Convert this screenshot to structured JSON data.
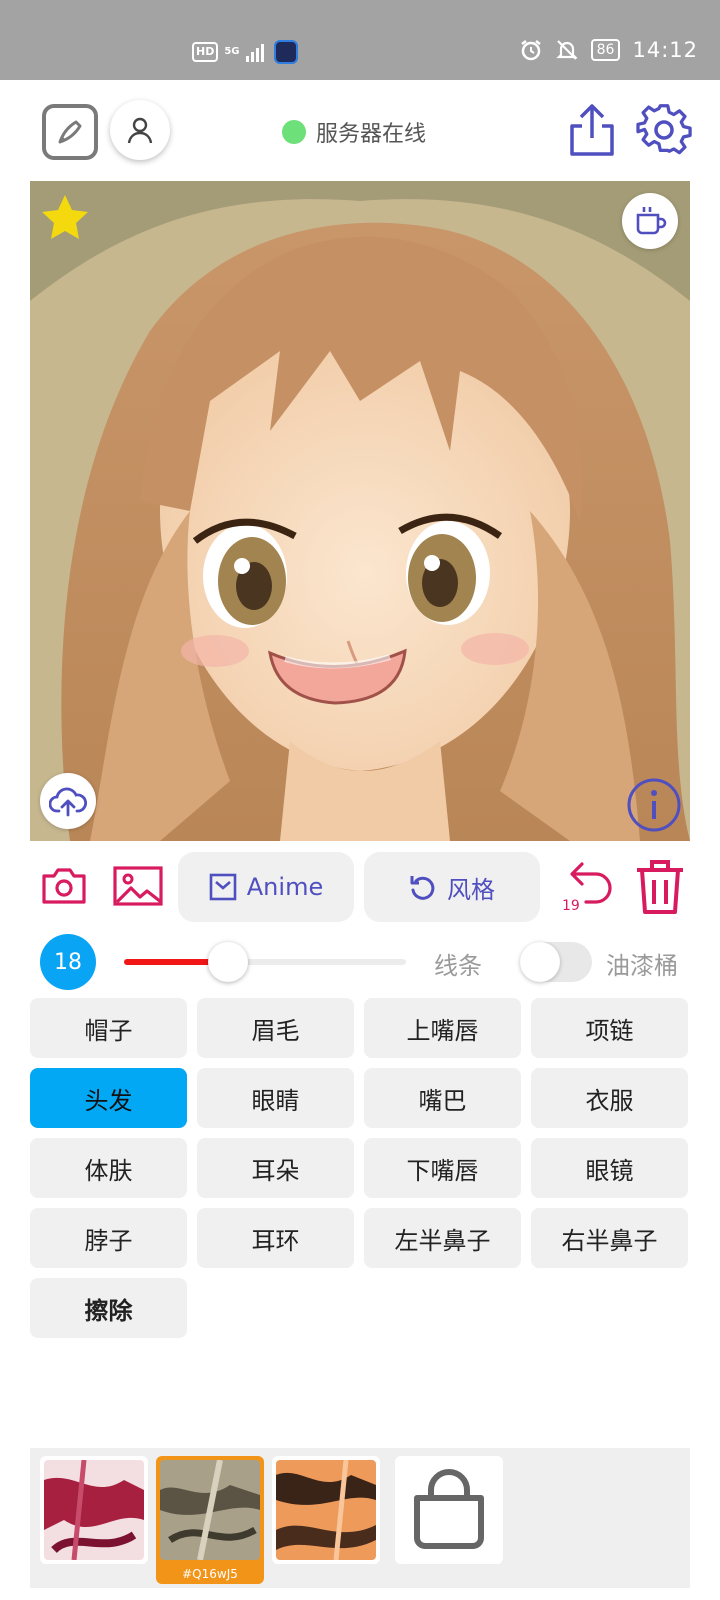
{
  "status_bar": {
    "network_badge": "HD",
    "network_type": "5G",
    "battery": "86",
    "time": "14:12"
  },
  "header": {
    "server_status": "服务器在线",
    "status_color": "#6de07a"
  },
  "icons": {
    "edit": "edit-pen-icon",
    "user": "user-icon",
    "share": "share-icon",
    "settings": "gear-icon",
    "favorite": "star-icon",
    "coffee": "coffee-cup-icon",
    "upload": "cloud-upload-icon",
    "info": "info-icon",
    "camera": "camera-icon",
    "gallery": "image-icon",
    "undo": "undo-icon",
    "delete": "trash-icon",
    "shop": "shopping-bag-icon"
  },
  "toolbar": {
    "mode_label": "Anime",
    "style_label": "风格",
    "undo_count": "19"
  },
  "brush": {
    "size": "18",
    "slider_value": 0.37,
    "line_label": "线条",
    "bucket_label": "油漆桶",
    "bucket_enabled": false
  },
  "categories": [
    {
      "label": "帽子"
    },
    {
      "label": "眉毛"
    },
    {
      "label": "上嘴唇"
    },
    {
      "label": "项链"
    },
    {
      "label": "头发"
    },
    {
      "label": "眼睛"
    },
    {
      "label": "嘴巴"
    },
    {
      "label": "衣服"
    },
    {
      "label": "体肤"
    },
    {
      "label": "耳朵"
    },
    {
      "label": "下嘴唇"
    },
    {
      "label": "眼镜"
    },
    {
      "label": "脖子"
    },
    {
      "label": "耳环"
    },
    {
      "label": "左半鼻子"
    },
    {
      "label": "右半鼻子"
    },
    {
      "label": "擦除"
    }
  ],
  "selected_category": "头发",
  "textures": [
    {
      "caption": ""
    },
    {
      "caption": "#Q16wJ5"
    },
    {
      "caption": ""
    }
  ],
  "colors": {
    "accent_pink": "#d81b5f",
    "accent_indigo": "#4f4fc0",
    "active_blue": "#03a8f4",
    "slider_red": "#f21717",
    "selected_texture": "#f29418"
  }
}
